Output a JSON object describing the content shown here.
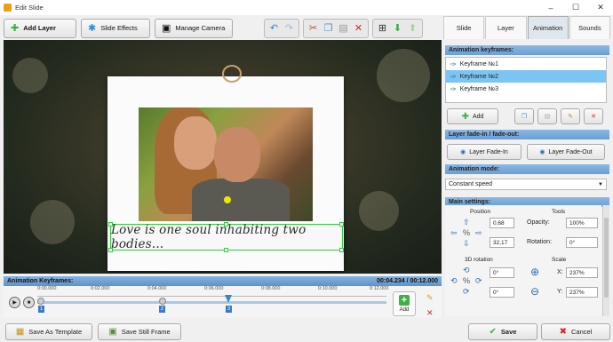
{
  "window": {
    "title": "Edit Slide"
  },
  "toolbar": {
    "add_layer": "Add Layer",
    "slide_effects": "Slide Effects",
    "manage_camera": "Manage Camera"
  },
  "canvas": {
    "caption": "Love is one soul inhabiting two bodies..."
  },
  "timeline": {
    "header": "Animation Keyframes:",
    "time": "00:04.234 / 00:12.000",
    "ticks": [
      "0:00.000",
      "0:02.000",
      "0:04.000",
      "0:06.000",
      "0:08.000",
      "0:10.000",
      "0:12.000"
    ],
    "keyframes": [
      "1",
      "2",
      "3"
    ],
    "add_label": "Add"
  },
  "panel": {
    "tabs": [
      "Slide",
      "Layer",
      "Animation",
      "Sounds"
    ],
    "active_tab": "Animation",
    "keyframes_header": "Animation keyframes:",
    "keyframes": [
      "Keyframe №1",
      "Keyframe №2",
      "Keyframe №3"
    ],
    "selected_keyframe": "Keyframe №2",
    "add_label": "Add",
    "fade_header": "Layer fade-in / fade-out:",
    "fade_in": "Layer Fade-In",
    "fade_out": "Layer Fade-Out",
    "mode_header": "Animation mode:",
    "mode_value": "Constant speed",
    "settings_header": "Main settings:",
    "position_label": "Position",
    "tools_label": "Tools",
    "pos_x": "0,68",
    "pos_y": "32,17",
    "opacity_label": "Opacity:",
    "opacity_value": "100%",
    "rotation_label": "Rotation:",
    "rotation_value": "0°",
    "rotation3d_label": "3D rotation",
    "scale_label": "Scale",
    "rot3d_x": "0°",
    "rot3d_y": "0°",
    "scale_x_label": "X:",
    "scale_x": "237%",
    "scale_y_label": "Y:",
    "scale_y": "237%"
  },
  "footer": {
    "save_template": "Save As Template",
    "save_frame": "Save Still Frame",
    "save": "Save",
    "cancel": "Cancel"
  },
  "colors": {
    "accent": "#6a9ed2",
    "selection": "#7cc4f4",
    "add_green": "#3cb043",
    "selection_frame": "#2ecc40"
  }
}
